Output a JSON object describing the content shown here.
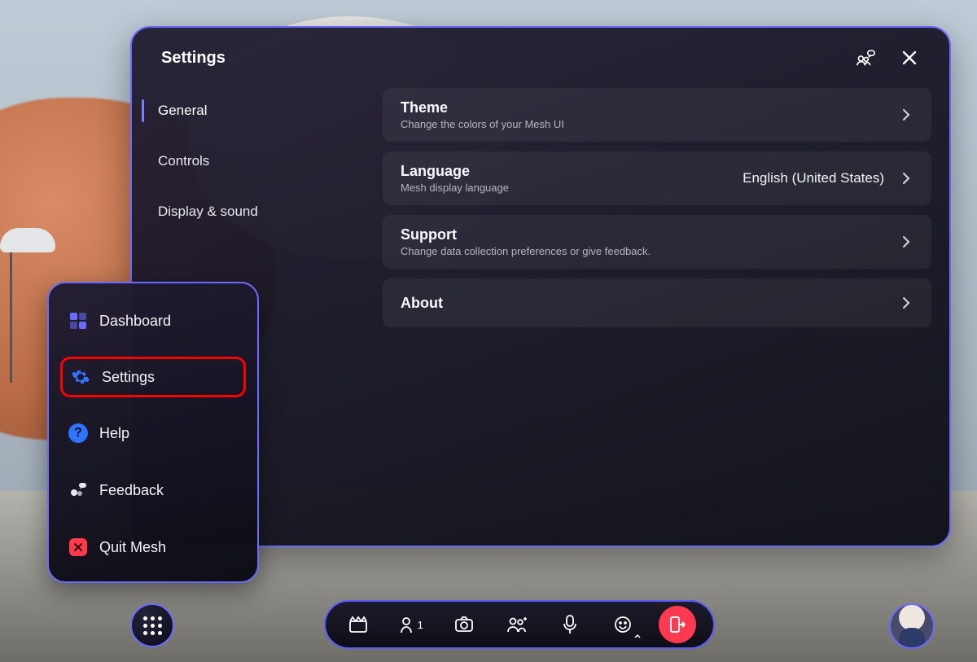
{
  "settings": {
    "title": "Settings",
    "nav": [
      {
        "label": "General",
        "active": true
      },
      {
        "label": "Controls",
        "active": false
      },
      {
        "label": "Display & sound",
        "active": false
      }
    ],
    "rows": {
      "theme": {
        "title": "Theme",
        "sub": "Change the colors of your Mesh UI"
      },
      "language": {
        "title": "Language",
        "sub": "Mesh display language",
        "value": "English (United States)"
      },
      "support": {
        "title": "Support",
        "sub": "Change data collection preferences or give feedback."
      },
      "about": {
        "title": "About"
      }
    }
  },
  "menu": {
    "items": [
      {
        "key": "dashboard",
        "label": "Dashboard"
      },
      {
        "key": "settings",
        "label": "Settings"
      },
      {
        "key": "help",
        "label": "Help"
      },
      {
        "key": "feedback",
        "label": "Feedback"
      },
      {
        "key": "quit",
        "label": "Quit Mesh"
      }
    ]
  },
  "toolbar": {
    "participants_count": "1"
  }
}
